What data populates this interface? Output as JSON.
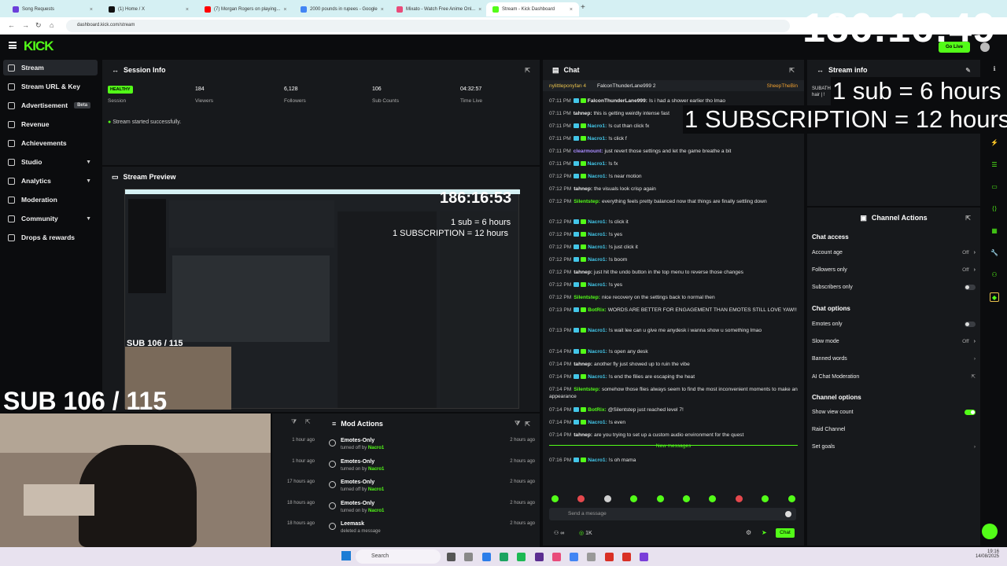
{
  "browser": {
    "tabs": [
      {
        "label": "Song Requests",
        "color": "#6b3fd9"
      },
      {
        "label": "(1) Home / X",
        "color": "#111111"
      },
      {
        "label": "(7) Morgan Rogers on playing...",
        "color": "#ff0000"
      },
      {
        "label": "2000 pounds in rupees - Google",
        "color": "#4285f4"
      },
      {
        "label": "Mixato - Watch Free Anime Onl...",
        "color": "#e94b7a"
      },
      {
        "label": "Stream - Kick Dashboard",
        "color": "#53fc18"
      }
    ],
    "url": "dashboard.kick.com/stream"
  },
  "header": {
    "logo": "KICK",
    "go_live": "Go Live"
  },
  "sidebar": {
    "items": [
      {
        "label": "Stream",
        "icon": "stream-icon",
        "active": true
      },
      {
        "label": "Stream URL & Key",
        "icon": "link-icon"
      },
      {
        "label": "Advertisement",
        "icon": "megaphone-icon",
        "badge": "Beta"
      },
      {
        "label": "Revenue",
        "icon": "money-icon"
      },
      {
        "label": "Achievements",
        "icon": "trophy-icon"
      },
      {
        "label": "Studio",
        "icon": "studio-icon",
        "chevron": true
      },
      {
        "label": "Analytics",
        "icon": "chart-icon",
        "chevron": true
      },
      {
        "label": "Moderation",
        "icon": "shield-icon"
      },
      {
        "label": "Community",
        "icon": "users-icon",
        "chevron": true
      },
      {
        "label": "Drops & rewards",
        "icon": "gift-icon"
      }
    ]
  },
  "session": {
    "title": "Session Info",
    "status": "HEALTHY",
    "status_label": "Session",
    "viewers": "184",
    "viewers_label": "Viewers",
    "followers": "6,128",
    "followers_label": "Followers",
    "subs": "106",
    "subs_label": "Sub Counts",
    "time": "04:32:57",
    "time_label": "Time Live",
    "message": "Stream started successfully."
  },
  "preview": {
    "title": "Stream Preview"
  },
  "chat": {
    "title": "Chat",
    "pinned": [
      "nylittleponyfan 4",
      "FalconThunderLane999 2",
      "SheepTheBin"
    ],
    "messages": [
      {
        "time": "07:11 PM",
        "user": "FalconThunderLane999:",
        "text": "Is i had a shower earlier tho lmao",
        "badge": true
      },
      {
        "time": "07:11 PM",
        "user": "tahnep:",
        "text": "this is getting weirdly intense fast"
      },
      {
        "time": "07:11 PM",
        "user": "Nacro1:",
        "text": "!s cut than click fx",
        "badge": true
      },
      {
        "time": "07:11 PM",
        "user": "Nacro1:",
        "text": "!s click f",
        "badge": true
      },
      {
        "time": "07:11 PM",
        "user": "clearmount:",
        "text": "just revert those settings and let the game breathe a bit"
      },
      {
        "time": "07:11 PM",
        "user": "Nacro1:",
        "text": "!s fx",
        "badge": true
      },
      {
        "time": "07:12 PM",
        "user": "Nacro1:",
        "text": "!s near motion",
        "badge": true
      },
      {
        "time": "07:12 PM",
        "user": "tahnep:",
        "text": "the visuals look crisp again"
      },
      {
        "time": "07:12 PM",
        "user": "Silentstep:",
        "text": "everything feels pretty balanced now that things are finally settling down"
      },
      {
        "time": "07:12 PM",
        "user": "Nacro1:",
        "text": "!s click it",
        "badge": true
      },
      {
        "time": "07:12 PM",
        "user": "Nacro1:",
        "text": "!s yes",
        "badge": true
      },
      {
        "time": "07:12 PM",
        "user": "Nacro1:",
        "text": "!s just click it",
        "badge": true
      },
      {
        "time": "07:12 PM",
        "user": "Nacro1:",
        "text": "!s boom",
        "badge": true
      },
      {
        "time": "07:12 PM",
        "user": "tahnep:",
        "text": "just hit the undo button in the top menu to reverse those changes"
      },
      {
        "time": "07:12 PM",
        "user": "Nacro1:",
        "text": "!s yes",
        "badge": true
      },
      {
        "time": "07:12 PM",
        "user": "Silentstep:",
        "text": "nice recovery on the settings back to normal then"
      },
      {
        "time": "07:13 PM",
        "user": "BotRix:",
        "text": "WORDS ARE BETTER FOR ENGAGEMENT THAN EMOTES STILL LOVE YAW!!",
        "badge": true
      },
      {
        "time": "07:13 PM",
        "user": "Nacro1:",
        "text": "!s wait lee can u give me anydesk i wanna show u something lmao",
        "badge": true
      },
      {
        "time": "07:14 PM",
        "user": "Nacro1:",
        "text": "!s open any desk",
        "badge": true
      },
      {
        "time": "07:14 PM",
        "user": "tahnep:",
        "text": "another fly just showed up to ruin the vibe"
      },
      {
        "time": "07:14 PM",
        "user": "Nacro1:",
        "text": "!s end the filies are escaping the heat",
        "badge": true
      },
      {
        "time": "07:14 PM",
        "user": "Silentstep:",
        "text": "somehow those flies always seem to find the most inconvenient moments to make an appearance"
      },
      {
        "time": "07:14 PM",
        "user": "BotRix:",
        "text": "@Silentstep just reached level 7!",
        "badge": true
      },
      {
        "time": "07:14 PM",
        "user": "Nacro1:",
        "text": "!s even",
        "badge": true
      },
      {
        "time": "07:14 PM",
        "user": "tahnep:",
        "text": "are you trying to set up a custom audio environment for the quest"
      },
      {
        "time": "07:16 PM",
        "user": "Nacro1:",
        "text": "!s oh mama",
        "badge": true
      }
    ],
    "new_messages": "New messages",
    "input_placeholder": "Send a message",
    "viewer_count": "1K",
    "chat_button": "Chat"
  },
  "stream_info": {
    "title": "Stream info",
    "text": "SUBATHON",
    "text2": "hair | !"
  },
  "channel_actions": {
    "title": "Channel Actions",
    "chat_access": "Chat access",
    "account_age": "Account age",
    "account_age_value": "Off",
    "followers_only": "Followers only",
    "followers_only_value": "Off",
    "subscribers_only": "Subscribers only",
    "chat_options": "Chat options",
    "emotes_only": "Emotes only",
    "slow_mode": "Slow mode",
    "slow_mode_value": "Off",
    "banned_words": "Banned words",
    "ai_moderation": "AI Chat Moderation",
    "channel_options": "Channel options",
    "show_view_count": "Show view count",
    "raid_channel": "Raid Channel",
    "set_goals": "Set goals"
  },
  "mod_actions": {
    "title": "Mod Actions",
    "items": [
      {
        "title": "Emotes-Only",
        "sub": "turned off by",
        "by": "Nacro1",
        "time": "2 hours ago"
      },
      {
        "title": "Emotes-Only",
        "sub": "turned on by",
        "by": "Nacro1",
        "time": "2 hours ago"
      },
      {
        "title": "Emotes-Only",
        "sub": "turned off by",
        "by": "Nacro1",
        "time": "2 hours ago"
      },
      {
        "title": "Emotes-Only",
        "sub": "turned on by",
        "by": "Nacro1",
        "time": "2 hours ago"
      },
      {
        "title": "Leemask",
        "sub": "deleted a message",
        "by": "",
        "time": "2 hours ago"
      }
    ],
    "left_times": [
      "1 hour ago",
      "1 hour ago",
      "17 hours ago",
      "18 hours ago",
      "18 hours ago"
    ]
  },
  "overlays": {
    "timer": "186:16:49",
    "sub_rule1": "1 sub = 6 hours",
    "sub_rule2": "1 SUBSCRIPTION = 12 hours",
    "sub_count": "SUB 106 / 115",
    "preview_timer": "186:16:53",
    "preview_rule1": "1 sub = 6 hours",
    "preview_rule2": "1 SUBSCRIPTION = 12 hours",
    "preview_sub": "SUB 106 / 115"
  },
  "taskbar": {
    "search": "Search",
    "time": "19:16",
    "date": "14/08/2025"
  }
}
